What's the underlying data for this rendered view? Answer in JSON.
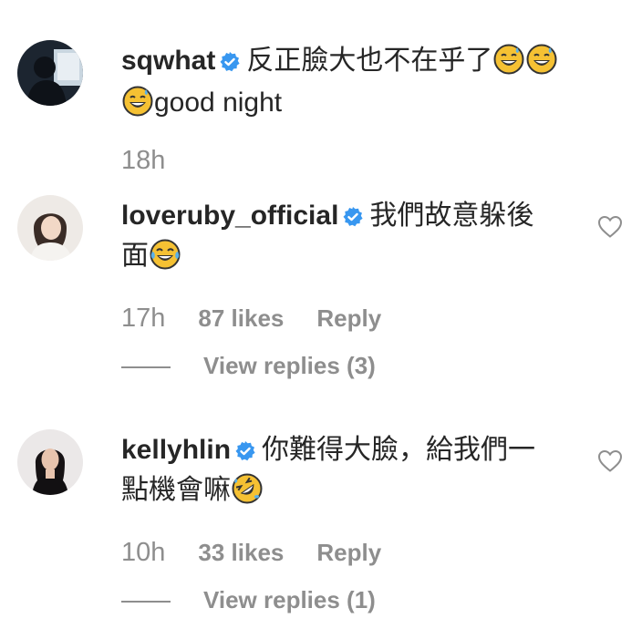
{
  "comments": [
    {
      "username": "sqwhat",
      "text_before": "反正臉大也不在乎了",
      "text_after": "good night",
      "time": "18h",
      "likes": "",
      "reply": "",
      "view_replies": "",
      "emojis": [
        "grinning-sweat-emoji",
        "grinning-sweat-emoji",
        "grinning-sweat-emoji"
      ]
    },
    {
      "username": "loveruby_official",
      "text_before": "我們故意躲後",
      "text_after": "面",
      "time": "17h",
      "likes": "87 likes",
      "reply": "Reply",
      "view_replies": "View replies (3)",
      "emojis": [
        "tears-of-joy-emoji"
      ]
    },
    {
      "username": "kellyhlin",
      "text_before": "你難得大臉，給我們一",
      "text_after": "點機會嘛",
      "time": "10h",
      "likes": "33 likes",
      "reply": "Reply",
      "view_replies": "View replies (1)",
      "emojis": [
        "rolling-laughing-emoji"
      ]
    }
  ],
  "colors": {
    "text": "#262626",
    "secondary": "#8e8e8e",
    "verified": "#3897f0",
    "emoji": "#f5c133"
  }
}
